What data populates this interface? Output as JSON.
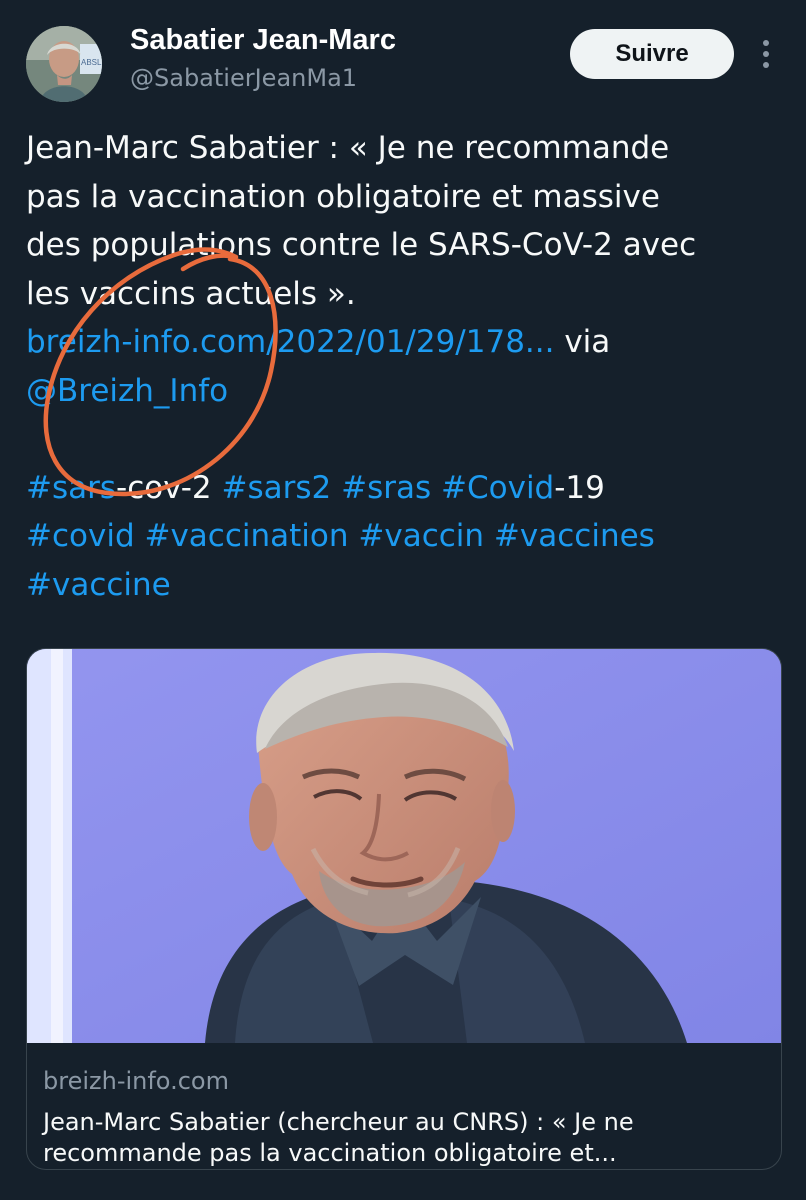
{
  "profile": {
    "name": "Sabatier Jean-Marc",
    "handle": "@SabatierJeanMa1",
    "avatar_icon": "profile-photo",
    "follow_label": "Suivre",
    "more_icon": "vertical-ellipsis-icon"
  },
  "tweet": {
    "line_1": "Jean-Marc Sabatier : « Je ne recommande",
    "line_2": "pas la vaccination obligatoire et massive",
    "line_3": "des populations contre le SARS-CoV-2 avec",
    "line_4": "les vaccins actuels ».",
    "link_text": "breizh-info.com/2022/01/29/178...",
    "via_text": " via",
    "mention": "@Breizh_Info",
    "hashtag_sars": "#sars",
    "hashtag_sars_suffix": "-cov-2",
    "hashtag_sars2": "#sars2",
    "hashtag_sras": "#sras",
    "hashtag_covid_cap": "#Covid",
    "hashtag_covid_cap_suffix": "-19",
    "hashtag_covid": "#covid",
    "hashtag_vaccination": "#vaccination",
    "hashtag_vaccin": "#vaccin",
    "hashtag_vaccines": "#vaccines",
    "hashtag_vaccine": "#vaccine"
  },
  "link_card": {
    "domain": "breizh-info.com",
    "title_line_1": "Jean-Marc Sabatier (chercheur au CNRS) : « Je ne",
    "title_line_2": "recommande pas la vaccination obligatoire et...",
    "image_icon": "portrait-photo"
  },
  "colors": {
    "background": "#15202b",
    "link": "#1d9bf0",
    "muted_text": "#8b98a5",
    "follow_button": "#eff3f4",
    "annotation_circle": "#e86b3c",
    "card_border": "#38444d"
  }
}
